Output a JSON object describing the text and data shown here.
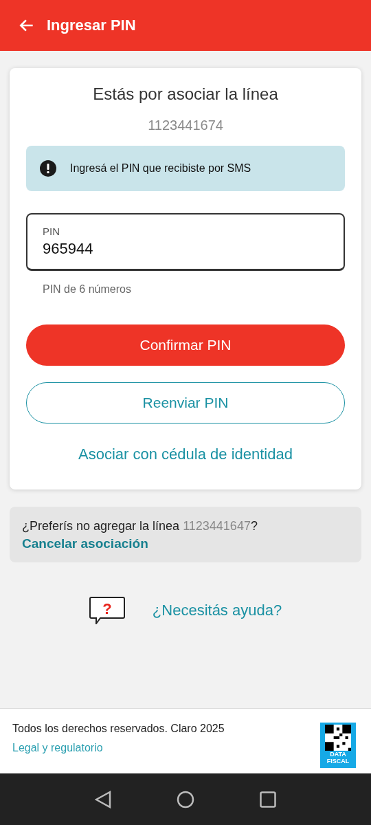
{
  "header": {
    "title": "Ingresar PIN"
  },
  "card": {
    "title": "Estás por asociar la línea",
    "line_number": "1123441674",
    "alert": {
      "text": "Ingresá el PIN que recibiste por SMS"
    },
    "pin_field": {
      "label": "PIN",
      "value": "965944",
      "helper": "PIN de 6 números"
    },
    "primary_button": "Confirmar PIN",
    "secondary_button": "Reenviar PIN",
    "link": "Asociar con cédula de identidad"
  },
  "cancel_panel": {
    "question_before": "¿Preferís no agregar la línea ",
    "line_number": "1123441647",
    "question_after": "?",
    "link": "Cancelar asociación"
  },
  "help": {
    "link": "¿Necesitás ayuda?",
    "icon_mark": "?"
  },
  "footer": {
    "copyright": "Todos los derechos reservados. Claro 2025",
    "link": "Legal y regulatorio",
    "badge_lines": [
      "DATA",
      "FISCAL"
    ]
  }
}
